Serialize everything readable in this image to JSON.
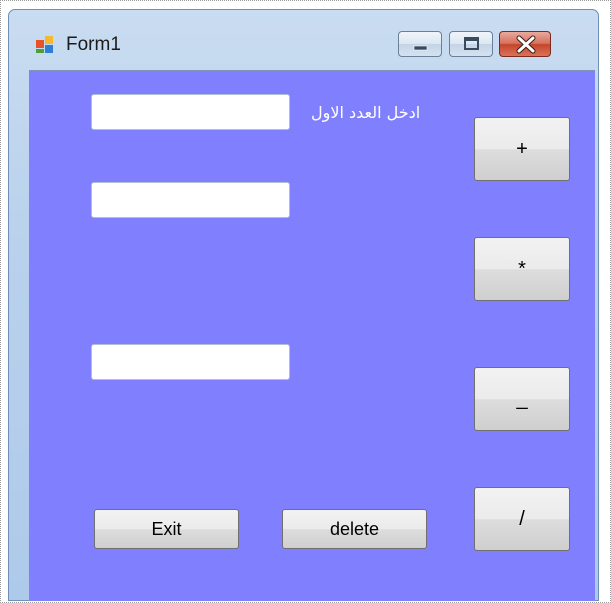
{
  "window": {
    "title": "Form1",
    "icon": "winforms-form-icon"
  },
  "caption_buttons": {
    "minimize": "minimize-icon",
    "maximize": "maximize-icon",
    "close": "close-icon"
  },
  "form": {
    "back_color": "#8080ff",
    "first_number_label": "ادخل العدد الاول",
    "first_number_value": "",
    "second_number_value": "",
    "result_value": ""
  },
  "operations": {
    "add_label": "+",
    "multiply_label": "*",
    "subtract_label": "_",
    "divide_label": "/"
  },
  "actions": {
    "exit_label": "Exit",
    "delete_label": "delete"
  }
}
